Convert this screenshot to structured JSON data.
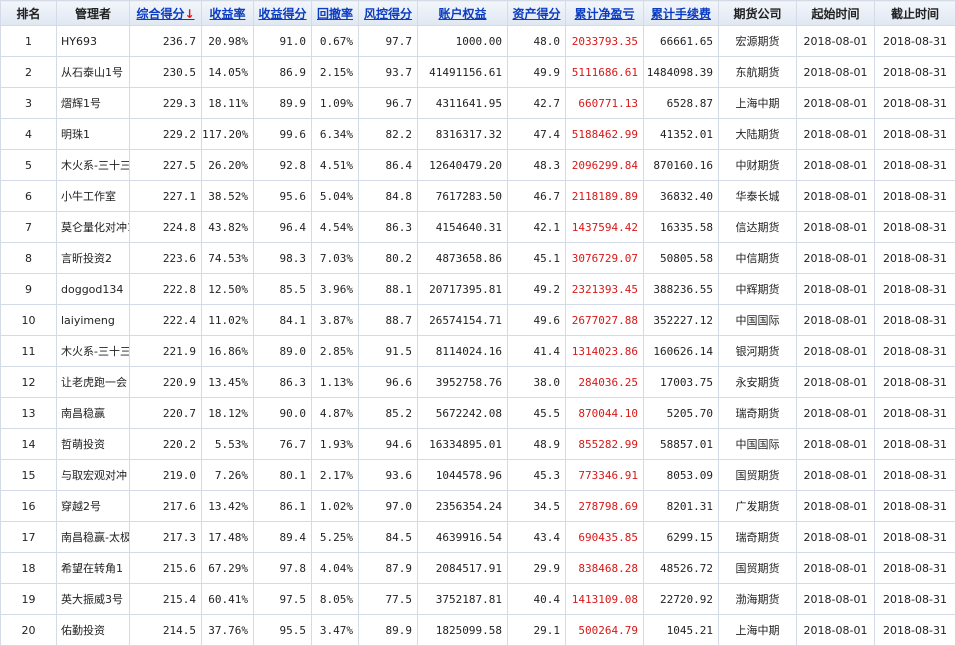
{
  "headers": [
    {
      "label": "排名",
      "sortable": false
    },
    {
      "label": "管理者",
      "sortable": false
    },
    {
      "label": "综合得分",
      "sortable": true,
      "sort_indicator": "↓"
    },
    {
      "label": "收益率",
      "sortable": true
    },
    {
      "label": "收益得分",
      "sortable": true
    },
    {
      "label": "回撤率",
      "sortable": true
    },
    {
      "label": "风控得分",
      "sortable": true
    },
    {
      "label": "账户权益",
      "sortable": true
    },
    {
      "label": "资产得分",
      "sortable": true
    },
    {
      "label": "累计净盈亏",
      "sortable": true
    },
    {
      "label": "累计手续费",
      "sortable": true
    },
    {
      "label": "期货公司",
      "sortable": false
    },
    {
      "label": "起始时间",
      "sortable": false
    },
    {
      "label": "截止时间",
      "sortable": false
    }
  ],
  "rows": [
    [
      "1",
      "HY693",
      "236.7",
      "20.98%",
      "91.0",
      "0.67%",
      "97.7",
      "1000.00",
      "48.0",
      "2033793.35",
      "66661.65",
      "宏源期货",
      "2018-08-01",
      "2018-08-31"
    ],
    [
      "2",
      "从石泰山1号",
      "230.5",
      "14.05%",
      "86.9",
      "2.15%",
      "93.7",
      "41491156.61",
      "49.9",
      "5111686.61",
      "1484098.39",
      "东航期货",
      "2018-08-01",
      "2018-08-31"
    ],
    [
      "3",
      "熠辉1号",
      "229.3",
      "18.11%",
      "89.9",
      "1.09%",
      "96.7",
      "4311641.95",
      "42.7",
      "660771.13",
      "6528.87",
      "上海中期",
      "2018-08-01",
      "2018-08-31"
    ],
    [
      "4",
      "明珠1",
      "229.2",
      "117.20%",
      "99.6",
      "6.34%",
      "82.2",
      "8316317.32",
      "47.4",
      "5188462.99",
      "41352.01",
      "大陆期货",
      "2018-08-01",
      "2018-08-31"
    ],
    [
      "5",
      "木火系-三十三l",
      "227.5",
      "26.20%",
      "92.8",
      "4.51%",
      "86.4",
      "12640479.20",
      "48.3",
      "2096299.84",
      "870160.16",
      "中财期货",
      "2018-08-01",
      "2018-08-31"
    ],
    [
      "6",
      "小牛工作室",
      "227.1",
      "38.52%",
      "95.6",
      "5.04%",
      "84.8",
      "7617283.50",
      "46.7",
      "2118189.89",
      "36832.40",
      "华泰长城",
      "2018-08-01",
      "2018-08-31"
    ],
    [
      "7",
      "莫仑量化对冲1·",
      "224.8",
      "43.82%",
      "96.4",
      "4.54%",
      "86.3",
      "4154640.31",
      "42.1",
      "1437594.42",
      "16335.58",
      "信达期货",
      "2018-08-01",
      "2018-08-31"
    ],
    [
      "8",
      "言昕投资2",
      "223.6",
      "74.53%",
      "98.3",
      "7.03%",
      "80.2",
      "4873658.86",
      "45.1",
      "3076729.07",
      "50805.58",
      "中信期货",
      "2018-08-01",
      "2018-08-31"
    ],
    [
      "9",
      "doggod134",
      "222.8",
      "12.50%",
      "85.5",
      "3.96%",
      "88.1",
      "20717395.81",
      "49.2",
      "2321393.45",
      "388236.55",
      "中辉期货",
      "2018-08-01",
      "2018-08-31"
    ],
    [
      "10",
      "laiyimeng",
      "222.4",
      "11.02%",
      "84.1",
      "3.87%",
      "88.7",
      "26574154.71",
      "49.6",
      "2677027.88",
      "352227.12",
      "中国国际",
      "2018-08-01",
      "2018-08-31"
    ],
    [
      "11",
      "木火系-三十三l",
      "221.9",
      "16.86%",
      "89.0",
      "2.85%",
      "91.5",
      "8114024.16",
      "41.4",
      "1314023.86",
      "160626.14",
      "银河期货",
      "2018-08-01",
      "2018-08-31"
    ],
    [
      "12",
      "让老虎跑一会",
      "220.9",
      "13.45%",
      "86.3",
      "1.13%",
      "96.6",
      "3952758.76",
      "38.0",
      "284036.25",
      "17003.75",
      "永安期货",
      "2018-08-01",
      "2018-08-31"
    ],
    [
      "13",
      "南昌稳赢",
      "220.7",
      "18.12%",
      "90.0",
      "4.87%",
      "85.2",
      "5672242.08",
      "45.5",
      "870044.10",
      "5205.70",
      "瑞奇期货",
      "2018-08-01",
      "2018-08-31"
    ],
    [
      "14",
      "哲萌投资",
      "220.2",
      "5.53%",
      "76.7",
      "1.93%",
      "94.6",
      "16334895.01",
      "48.9",
      "855282.99",
      "58857.01",
      "中国国际",
      "2018-08-01",
      "2018-08-31"
    ],
    [
      "15",
      "与取宏观对冲",
      "219.0",
      "7.26%",
      "80.1",
      "2.17%",
      "93.6",
      "1044578.96",
      "45.3",
      "773346.91",
      "8053.09",
      "国贸期货",
      "2018-08-01",
      "2018-08-31"
    ],
    [
      "16",
      "穿越2号",
      "217.6",
      "13.42%",
      "86.1",
      "1.02%",
      "97.0",
      "2356354.24",
      "34.5",
      "278798.69",
      "8201.31",
      "广发期货",
      "2018-08-01",
      "2018-08-31"
    ],
    [
      "17",
      "南昌稳赢-太极",
      "217.3",
      "17.48%",
      "89.4",
      "5.25%",
      "84.5",
      "4639916.54",
      "43.4",
      "690435.85",
      "6299.15",
      "瑞奇期货",
      "2018-08-01",
      "2018-08-31"
    ],
    [
      "18",
      "希望在转角1",
      "215.6",
      "67.29%",
      "97.8",
      "4.04%",
      "87.9",
      "2084517.91",
      "29.9",
      "838468.28",
      "48526.72",
      "国贸期货",
      "2018-08-01",
      "2018-08-31"
    ],
    [
      "19",
      "英大振威3号",
      "215.4",
      "60.41%",
      "97.5",
      "8.05%",
      "77.5",
      "3752187.81",
      "40.4",
      "1413109.08",
      "22720.92",
      "渤海期货",
      "2018-08-01",
      "2018-08-31"
    ],
    [
      "20",
      "佑勤投资",
      "214.5",
      "37.76%",
      "95.5",
      "3.47%",
      "89.9",
      "1825099.58",
      "29.1",
      "500264.79",
      "1045.21",
      "上海中期",
      "2018-08-01",
      "2018-08-31"
    ]
  ],
  "colors": {
    "header_link": "#0b3cc1",
    "negative_profit": "#d81818",
    "border": "#d4dbe6"
  }
}
